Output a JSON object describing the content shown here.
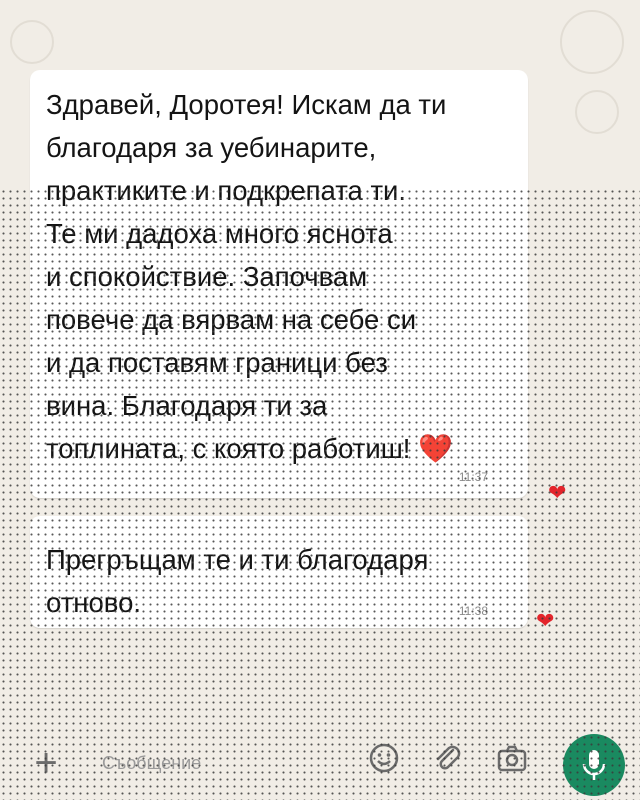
{
  "chat": {
    "messages": [
      {
        "text": "Здравей, Доротея! Искам да ти\nблагодаря за уебинарите,\nпрактиките и подкрепата ти.\nТе ми дадоха много яснота\nи спокойствие. Започвам\nповече да вярвам на себе си\nи да поставям граници без\nвина. Благодаря ти за\nтоплината, с която работиш! ",
        "emoji": "❤️",
        "time": "11:37",
        "reaction": "❤"
      },
      {
        "text": "Прегръщам те и ти благодаря\nотново.",
        "time": "11:38",
        "reaction": "❤"
      }
    ]
  },
  "input_bar": {
    "plus_icon": "plus-icon",
    "placeholder": "Съобщение",
    "icons": [
      "emoji-icon",
      "paperclip-icon",
      "camera-icon",
      "microphone-icon"
    ],
    "accent_color": "#1a8a60"
  }
}
